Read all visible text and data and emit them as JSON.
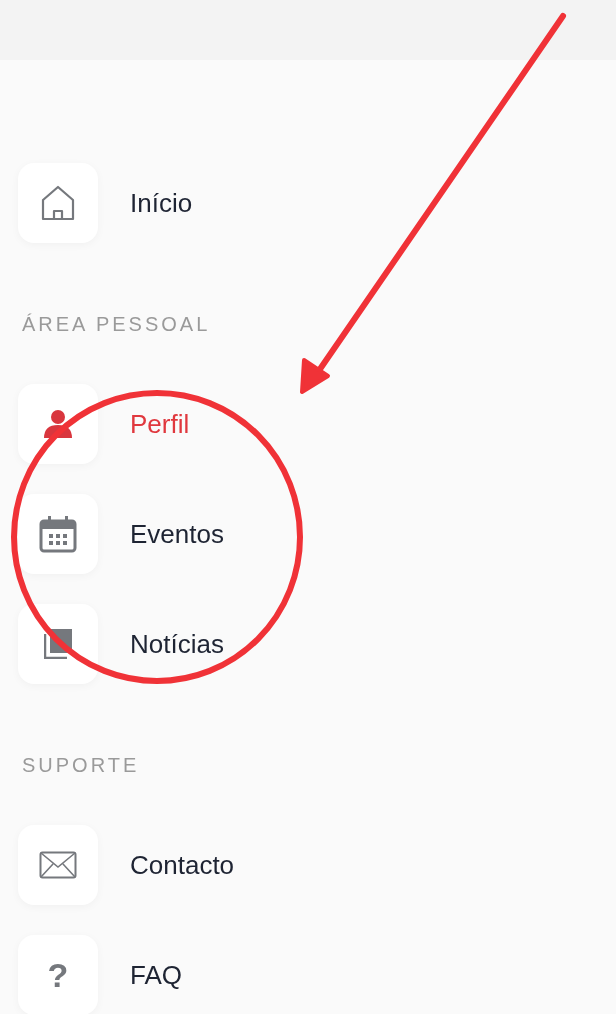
{
  "menu": {
    "sections": [
      {
        "items": [
          {
            "kind": "home",
            "label": "Início",
            "selected": false
          }
        ]
      },
      {
        "title": "ÁREA PESSOAL",
        "items": [
          {
            "kind": "person",
            "label": "Perfil",
            "selected": true
          },
          {
            "kind": "calendar",
            "label": "Eventos",
            "selected": false
          },
          {
            "kind": "document",
            "label": "Notícias",
            "selected": false
          }
        ]
      },
      {
        "title": "SUPORTE",
        "items": [
          {
            "kind": "mail",
            "label": "Contacto",
            "selected": false
          },
          {
            "kind": "glyph",
            "glyph": "?",
            "label": "FAQ",
            "selected": false
          }
        ]
      }
    ]
  }
}
